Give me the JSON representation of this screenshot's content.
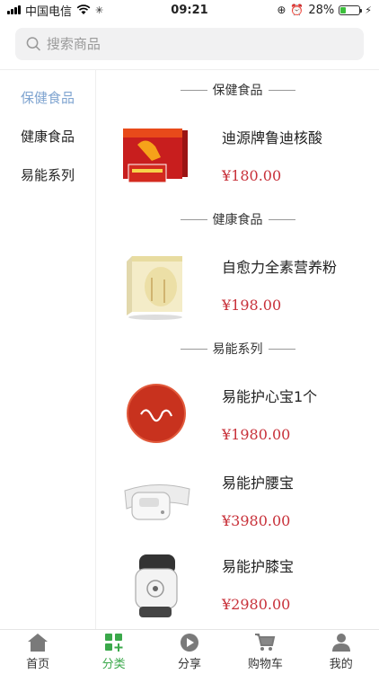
{
  "status_bar": {
    "carrier": "中国电信",
    "time": "09:21",
    "battery_percent": "28%",
    "battery_level": 0.28
  },
  "search": {
    "placeholder": "搜索商品"
  },
  "sidebar": {
    "items": [
      {
        "label": "保健食品",
        "active": true
      },
      {
        "label": "健康食品",
        "active": false
      },
      {
        "label": "易能系列",
        "active": false
      }
    ]
  },
  "sections": [
    {
      "title": "保健食品",
      "products": [
        {
          "name": "迪源牌鲁迪核酸",
          "price": "¥180.00"
        }
      ]
    },
    {
      "title": "健康食品",
      "products": [
        {
          "name": "自愈力全素营养粉",
          "price": "¥198.00"
        }
      ]
    },
    {
      "title": "易能系列",
      "products": [
        {
          "name": "易能护心宝1个",
          "price": "¥1980.00"
        },
        {
          "name": "易能护腰宝",
          "price": "¥3980.00"
        },
        {
          "name": "易能护膝宝",
          "price": "¥2980.00"
        }
      ]
    }
  ],
  "tabbar": {
    "items": [
      {
        "label": "首页",
        "icon": "home-icon"
      },
      {
        "label": "分类",
        "icon": "category-icon",
        "active": true
      },
      {
        "label": "分享",
        "icon": "share-icon"
      },
      {
        "label": "购物车",
        "icon": "cart-icon"
      },
      {
        "label": "我的",
        "icon": "user-icon"
      }
    ]
  },
  "colors": {
    "accent": "#3aa84a",
    "price": "#c8313a",
    "sidebar_active": "#7fa4d0"
  }
}
